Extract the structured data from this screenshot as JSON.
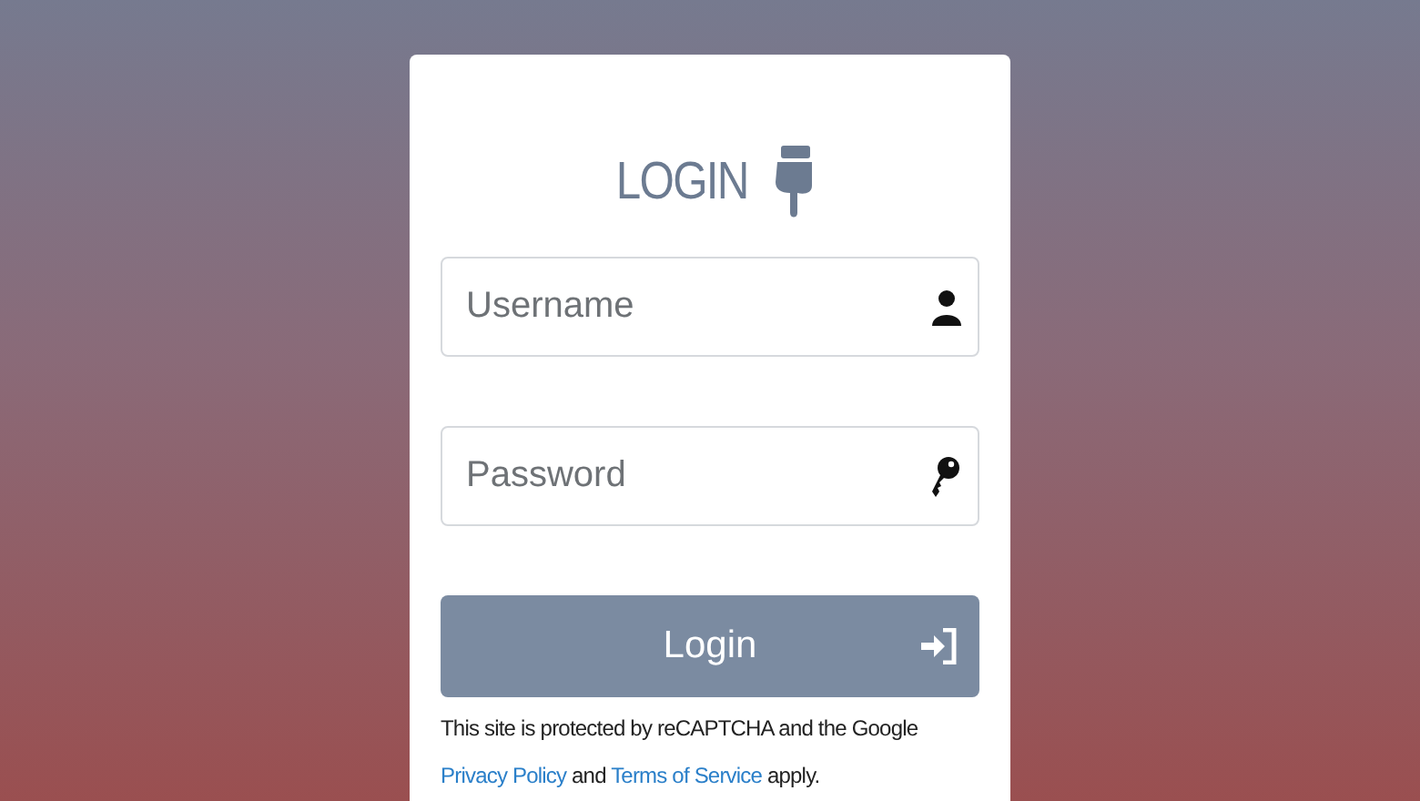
{
  "heading": "LOGIN",
  "fields": [
    {
      "placeholder": "Username",
      "kind": "user"
    },
    {
      "placeholder": "Password",
      "kind": "key"
    }
  ],
  "login_button": "Login",
  "notice": {
    "lead": "This site is protected by reCAPTCHA and the Google",
    "privacy_link": "Privacy Policy",
    "middle": "and",
    "terms_link": "Terms of Service",
    "tail": "apply."
  }
}
